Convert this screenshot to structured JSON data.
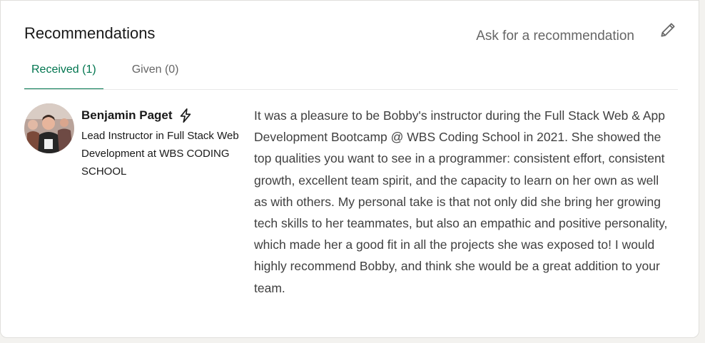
{
  "section": {
    "title": "Recommendations",
    "ask_link": "Ask for a recommendation",
    "edit_icon": "pencil-icon"
  },
  "tabs": [
    {
      "label": "Received (1)",
      "active": true
    },
    {
      "label": "Given (0)",
      "active": false
    }
  ],
  "recommendation": {
    "author_name": "Benjamin Paget",
    "badge_icon": "lightning-bolt-icon",
    "author_headline": "Lead Instructor in Full Stack Web Development at WBS CODING SCHOOL",
    "text": "It was a pleasure to be Bobby's instructor during the Full Stack Web & App Development Bootcamp @ WBS Coding School in 2021. She showed the top qualities you want to see in a programmer: consistent effort, consistent growth, excellent team spirit, and the capacity to learn on her own as well as with others. My personal take is that not only did she bring her growing tech skills to her teammates, but also an empathic and positive personality, which made her a good fit in all the projects she was exposed to! I would highly recommend Bobby, and think she would be a great addition to your team."
  },
  "colors": {
    "accent_green": "#01754f",
    "muted_text": "#666666",
    "body_text": "#404040"
  }
}
